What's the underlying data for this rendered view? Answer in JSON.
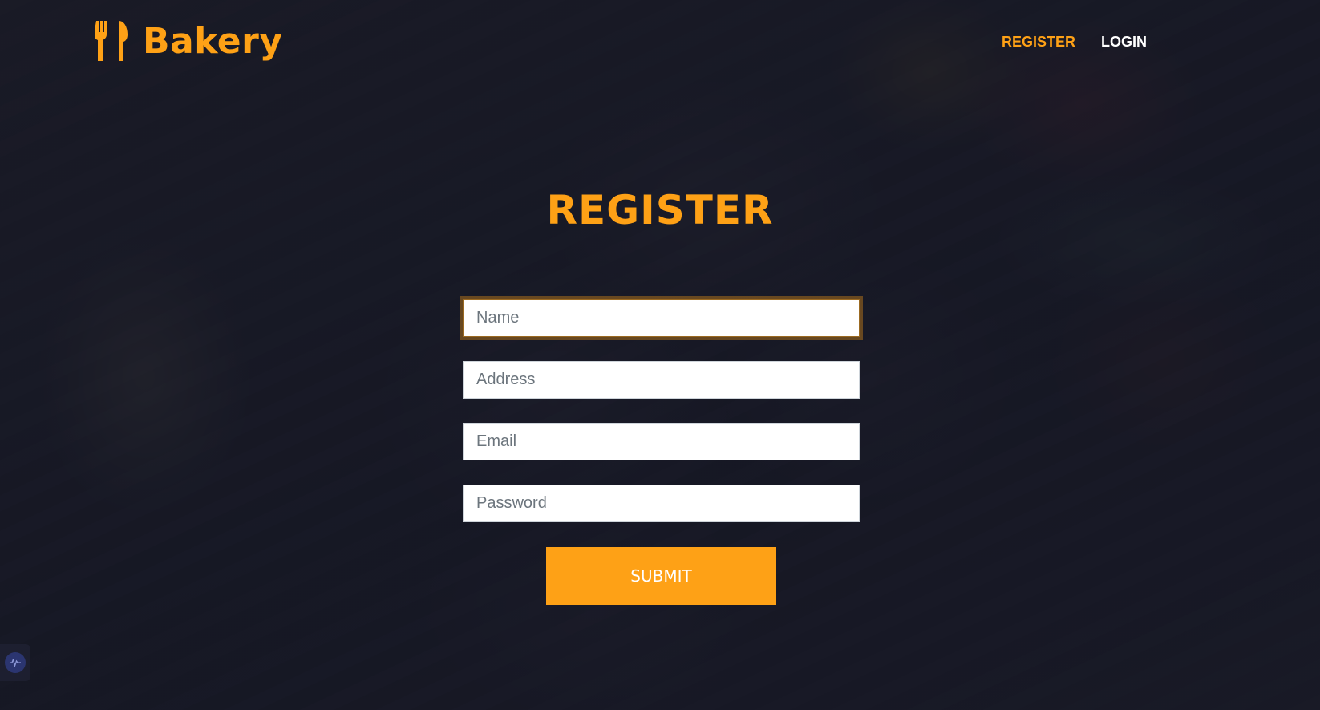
{
  "brand": {
    "name": "Bakery",
    "icon": "utensils-icon",
    "accent_color": "#fea116"
  },
  "nav": {
    "items": [
      {
        "label": "REGISTER",
        "active": true
      },
      {
        "label": "LOGIN",
        "active": false
      }
    ]
  },
  "form": {
    "title": "REGISTER",
    "fields": [
      {
        "placeholder": "Name",
        "value": "",
        "focused": true
      },
      {
        "placeholder": "Address",
        "value": ""
      },
      {
        "placeholder": "Email",
        "value": ""
      },
      {
        "placeholder": "Password",
        "value": ""
      }
    ],
    "submit_label": "SUBMIT"
  },
  "widget": {
    "icon": "audio-wave-icon"
  }
}
